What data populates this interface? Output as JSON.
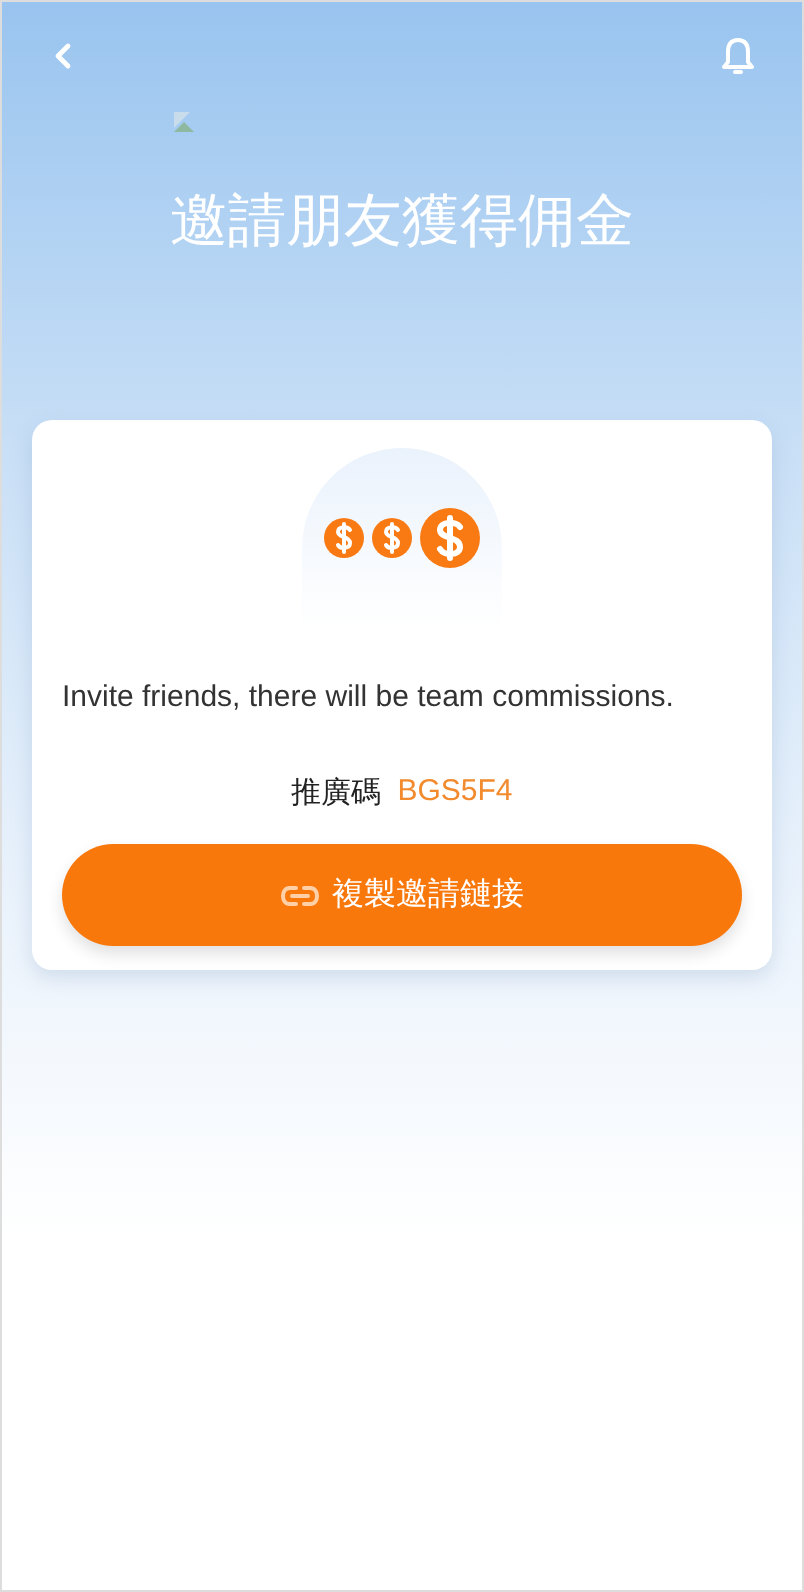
{
  "title": "邀請朋友獲得佣金",
  "card": {
    "message": "Invite friends, there will be team commissions.",
    "code_label": "推廣碼",
    "code": "BGS5F4",
    "button": "複製邀請鏈接"
  }
}
